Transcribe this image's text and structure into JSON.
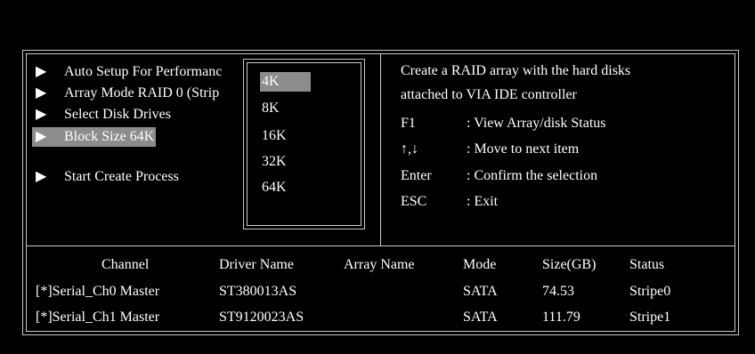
{
  "menu": {
    "arrow_glyph": "▶",
    "items": [
      {
        "label": "Auto Setup For Performanc"
      },
      {
        "label": "Array Mode RAID 0 (Strip"
      },
      {
        "label": "Select Disk Drives"
      },
      {
        "label": "Block Size 64K"
      },
      {
        "label": "Start Create Process"
      }
    ]
  },
  "popup": {
    "options": [
      "4K",
      "8K",
      "16K",
      "32K",
      "64K"
    ],
    "selected": "4K"
  },
  "help": {
    "line1": "Create a RAID array with the hard disks",
    "line2": "attached to VIA IDE controller",
    "keys": [
      {
        "key": "F1",
        "desc": ": View Array/disk Status"
      },
      {
        "key": "↑,↓",
        "desc": ": Move to next item"
      },
      {
        "key": "Enter",
        "desc": ": Confirm the selection"
      },
      {
        "key": "ESC",
        "desc": ": Exit"
      }
    ]
  },
  "table": {
    "headers": [
      "Channel",
      "Driver Name",
      "Array Name",
      "Mode",
      "Size(GB)",
      "Status"
    ],
    "rows": [
      [
        "[*]Serial_Ch0 Master",
        "ST380013AS",
        "",
        "SATA",
        "74.53",
        "Stripe0"
      ],
      [
        "[*]Serial_Ch1 Master",
        "ST9120023AS",
        "",
        "SATA",
        "111.79",
        "Stripe1"
      ]
    ]
  },
  "colors": {
    "background": "#000000",
    "text": "#ffffff",
    "highlight": "#8c8c8c",
    "border": "#c8c8c8"
  }
}
